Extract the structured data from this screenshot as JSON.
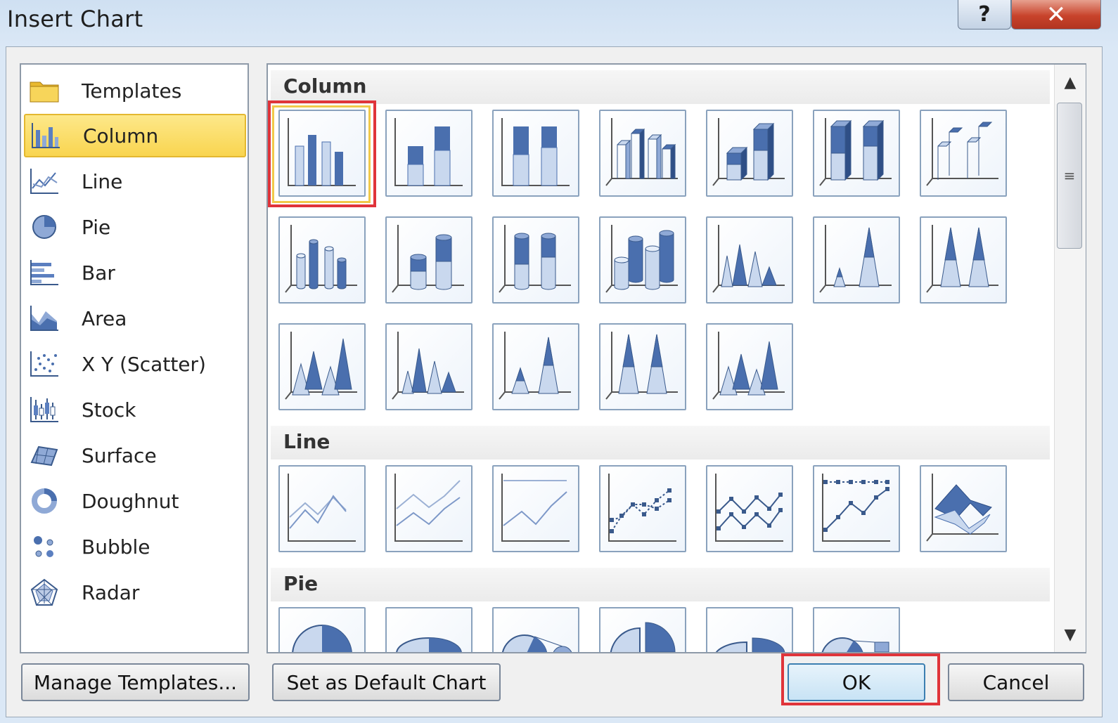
{
  "window": {
    "title": "Insert Chart",
    "help_label": "?",
    "close_label": "✕"
  },
  "categories": [
    {
      "label": "Templates",
      "icon": "folder-icon",
      "selected": false
    },
    {
      "label": "Column",
      "icon": "column-chart-icon",
      "selected": true
    },
    {
      "label": "Line",
      "icon": "line-chart-icon",
      "selected": false
    },
    {
      "label": "Pie",
      "icon": "pie-chart-icon",
      "selected": false
    },
    {
      "label": "Bar",
      "icon": "bar-chart-icon",
      "selected": false
    },
    {
      "label": "Area",
      "icon": "area-chart-icon",
      "selected": false
    },
    {
      "label": "X Y (Scatter)",
      "icon": "scatter-chart-icon",
      "selected": false
    },
    {
      "label": "Stock",
      "icon": "stock-chart-icon",
      "selected": false
    },
    {
      "label": "Surface",
      "icon": "surface-chart-icon",
      "selected": false
    },
    {
      "label": "Doughnut",
      "icon": "doughnut-chart-icon",
      "selected": false
    },
    {
      "label": "Bubble",
      "icon": "bubble-chart-icon",
      "selected": false
    },
    {
      "label": "Radar",
      "icon": "radar-chart-icon",
      "selected": false
    }
  ],
  "gallery": {
    "sections": [
      {
        "title": "Column"
      },
      {
        "title": "Line"
      },
      {
        "title": "Pie"
      }
    ]
  },
  "buttons": {
    "manage_templates": "Manage Templates...",
    "set_default": "Set as Default Chart",
    "ok": "OK",
    "cancel": "Cancel"
  },
  "colors": {
    "selection_outline": "#e0343a",
    "selected_category": "#f9d550",
    "chart_blue": "#4a6fae"
  }
}
